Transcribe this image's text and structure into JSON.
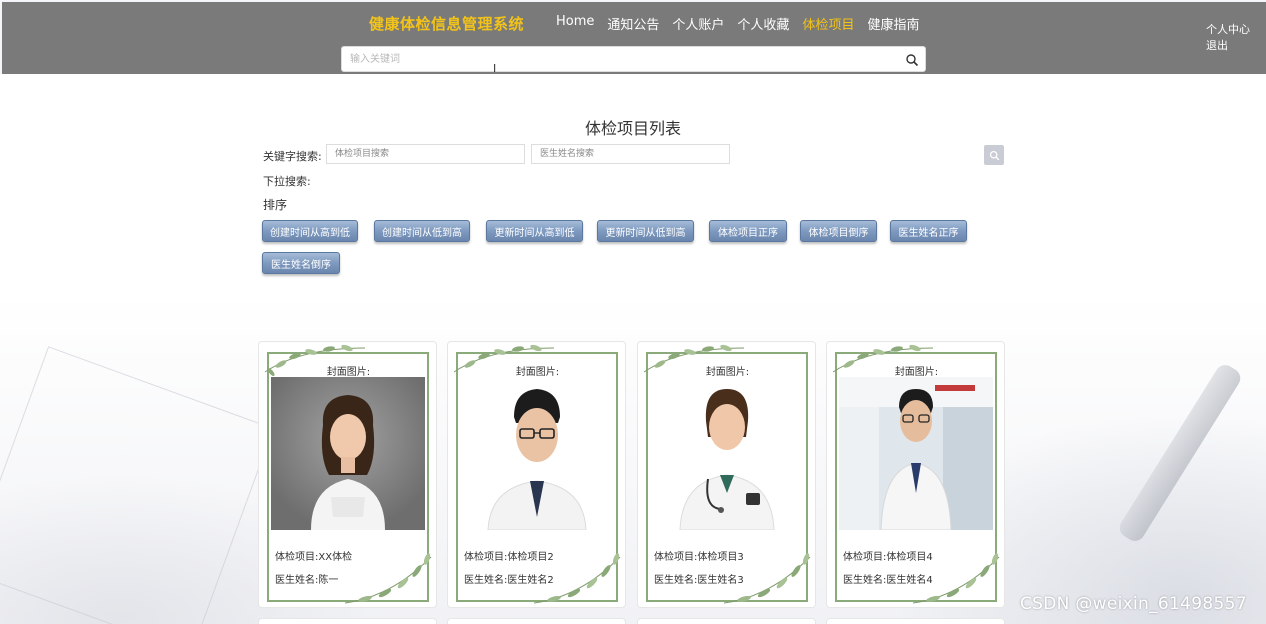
{
  "header": {
    "brand": "健康体检信息管理系统",
    "nav": [
      {
        "label": "Home",
        "active": false
      },
      {
        "label": "通知公告",
        "active": false
      },
      {
        "label": "个人账户",
        "active": false
      },
      {
        "label": "个人收藏",
        "active": false
      },
      {
        "label": "体检项目",
        "active": true
      },
      {
        "label": "健康指南",
        "active": false
      }
    ],
    "search_placeholder": "输入关键词",
    "user_center": "个人中心",
    "logout": "退出"
  },
  "main": {
    "title": "体检项目列表",
    "keyword_label": "关键字搜索:",
    "project_placeholder": "体检项目搜索",
    "doctor_placeholder": "医生姓名搜索",
    "dropdown_label": "下拉搜索:",
    "sort_label": "排序",
    "sort_buttons": [
      "创建时间从高到低",
      "创建时间从低到高",
      "更新时间从高到低",
      "更新时间从低到高",
      "体检项目正序",
      "体检项目倒序",
      "医生姓名正序",
      "医生姓名倒序"
    ]
  },
  "cards": [
    {
      "cover_label": "封面图片:",
      "project": "体检项目:XX体检",
      "doctor": "医生姓名:陈一"
    },
    {
      "cover_label": "封面图片:",
      "project": "体检项目:体检项目2",
      "doctor": "医生姓名:医生姓名2"
    },
    {
      "cover_label": "封面图片:",
      "project": "体检项目:体检项目3",
      "doctor": "医生姓名:医生姓名3"
    },
    {
      "cover_label": "封面图片:",
      "project": "体检项目:体检项目4",
      "doctor": "医生姓名:医生姓名4"
    }
  ],
  "watermark": "CSDN @weixin_61498557",
  "colors": {
    "header_bg": "#7a7a7a",
    "brand": "#f2c318",
    "active_nav": "#f2c318",
    "sort_button": "#7f9ac0",
    "frame_green": "#8aaa7a"
  }
}
